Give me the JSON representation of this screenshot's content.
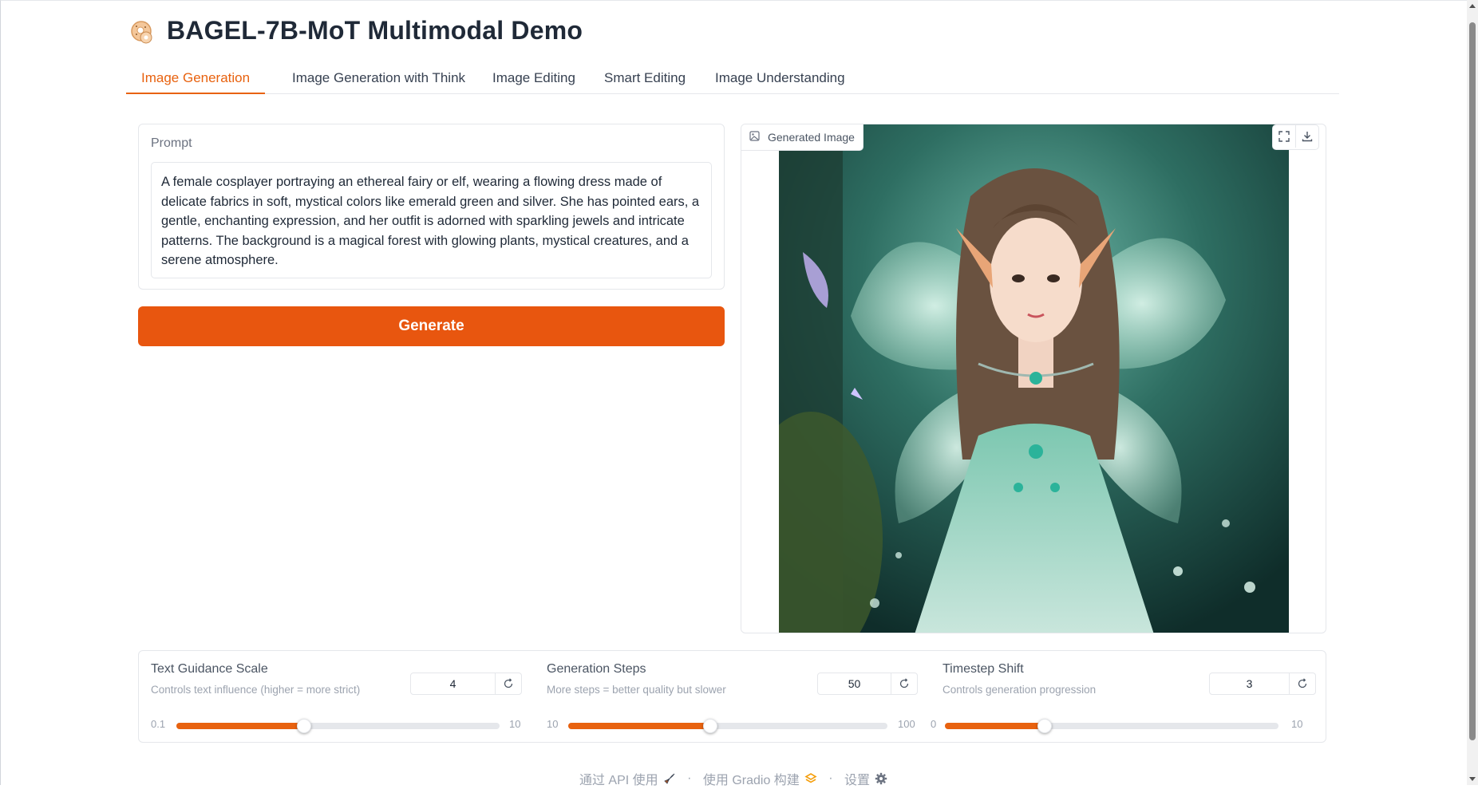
{
  "app": {
    "title": "BAGEL-7B-MoT Multimodal Demo",
    "logo_icon": "bagel-icon"
  },
  "tabs": [
    {
      "label": "Image Generation",
      "active": true
    },
    {
      "label": "Image Generation with Think",
      "active": false
    },
    {
      "label": "Image Editing",
      "active": false
    },
    {
      "label": "Smart Editing",
      "active": false
    },
    {
      "label": "Image Understanding",
      "active": false
    }
  ],
  "prompt": {
    "label": "Prompt",
    "value": "A female cosplayer portraying an ethereal fairy or elf, wearing a flowing dress made of delicate fabrics in soft, mystical colors like emerald green and silver. She has pointed ears, a gentle, enchanting expression, and her outfit is adorned with sparkling jewels and intricate patterns. The background is a magical forest with glowing plants, mystical creatures, and a serene atmosphere."
  },
  "generate_button": {
    "label": "Generate"
  },
  "output": {
    "label": "Generated Image",
    "fullscreen_icon": "fullscreen-icon",
    "download_icon": "download-icon"
  },
  "sliders": [
    {
      "label": "Text Guidance Scale",
      "info": "Controls text influence (higher = more strict)",
      "value": "4",
      "min": "0.1",
      "max": "10",
      "fraction": 0.394
    },
    {
      "label": "Generation Steps",
      "info": "More steps = better quality but slower",
      "value": "50",
      "min": "10",
      "max": "100",
      "fraction": 0.444
    },
    {
      "label": "Timestep Shift",
      "info": "Controls generation progression",
      "value": "3",
      "min": "0",
      "max": "10",
      "fraction": 0.3
    }
  ],
  "footer": {
    "api": "通过 API 使用",
    "built": "使用 Gradio 构建",
    "settings": "设置",
    "separator": "·"
  },
  "colors": {
    "accent": "#e8560f",
    "text": "#1f2937",
    "muted": "#9ca3af"
  }
}
